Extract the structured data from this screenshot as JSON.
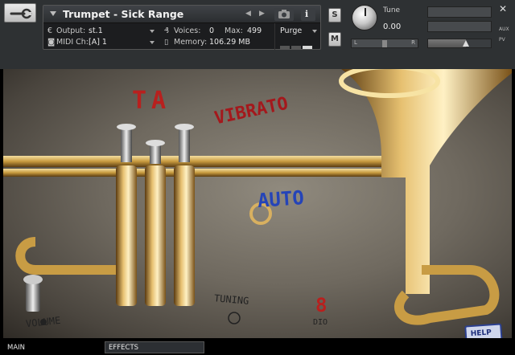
{
  "header": {
    "instrument_name": "Trumpet - Sick Range",
    "output": {
      "label": "Output:",
      "value": "st.1"
    },
    "voices": {
      "label": "Voices:",
      "value": "0",
      "max_label": "Max:",
      "max_value": "499"
    },
    "purge": {
      "label": "Purge"
    },
    "midi": {
      "label": "MIDI Ch:",
      "value": "[A]  1"
    },
    "memory": {
      "label": "Memory:",
      "value": "106.29 MB"
    },
    "solo_label": "S",
    "mute_label": "M",
    "tune": {
      "label": "Tune",
      "value": "0.00"
    },
    "pan": {
      "left": "L",
      "right": "R"
    },
    "volume_level": 0.6,
    "side_labels": {
      "aux": "AUX",
      "pv": "PV"
    },
    "icons": [
      "wrench-icon",
      "camera-icon",
      "info-icon",
      "close-icon"
    ]
  },
  "artwork": {
    "labels": {
      "ta": "TA",
      "vibrato": "VIBRATO",
      "auto": "AUTO",
      "tuning": "TUNING",
      "volume": "VOLUME",
      "number": "8",
      "dio": "DIO"
    },
    "help_button": "HELP"
  },
  "tabs": [
    {
      "label": "MAIN",
      "active": true
    },
    {
      "label": "EFFECTS",
      "active": false
    }
  ],
  "colors": {
    "header_bg": "#2e3133",
    "accent_red": "#b8201e",
    "accent_blue": "#2544b8",
    "brass": "#c49a3c"
  }
}
